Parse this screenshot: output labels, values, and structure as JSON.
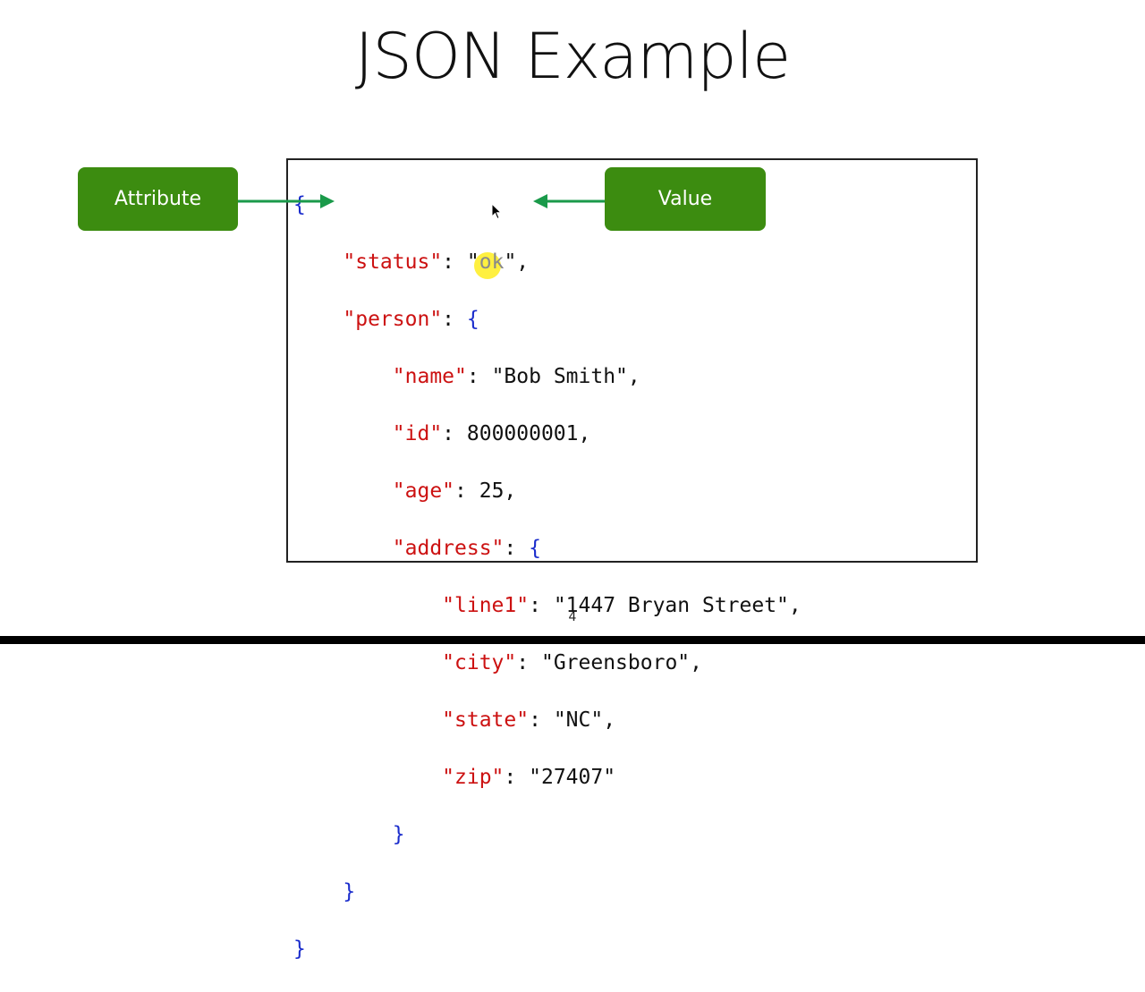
{
  "slide": {
    "title": "JSON Example",
    "page_number": "4"
  },
  "labels": {
    "attribute": "Attribute",
    "value": "Value"
  },
  "code": {
    "open_brace": "{",
    "status_key": "\"status\"",
    "status_value_open": "\"",
    "status_value_text": "ok",
    "status_value_close": "\",",
    "person_key": "\"person\"",
    "name_key": "\"name\"",
    "name_value": "\"Bob Smith\",",
    "id_key": "\"id\"",
    "id_value": "800000001,",
    "age_key": "\"age\"",
    "age_value": "25,",
    "address_key": "\"address\"",
    "line1_key": "\"line1\"",
    "line1_value": "\"1447 Bryan Street\",",
    "city_key": "\"city\"",
    "city_value": "\"Greensboro\",",
    "state_key": "\"state\"",
    "state_value": "\"NC\",",
    "zip_key": "\"zip\"",
    "zip_value": "\"27407\"",
    "close_brace": "}",
    "colon": ": "
  },
  "colors": {
    "key": "#cc1111",
    "brace": "#1a2ccc",
    "pill": "#3c8c10",
    "arrow": "#1a9a4a",
    "highlight": "#ffeb00"
  },
  "icons": {
    "cursor": "mouse-pointer-icon",
    "arrow_right": "arrow-right-icon",
    "arrow_left": "arrow-left-icon"
  }
}
